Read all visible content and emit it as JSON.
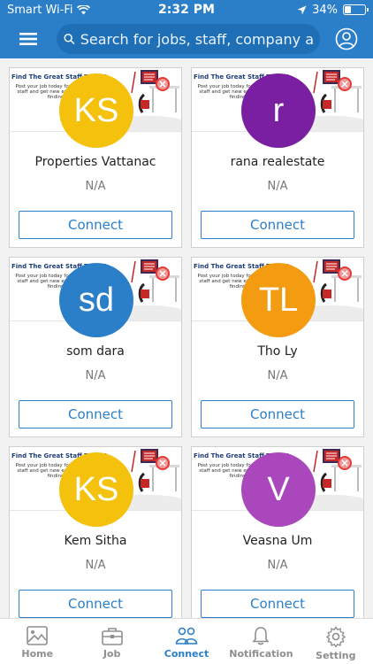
{
  "status": {
    "carrier": "Smart Wi-Fi",
    "time": "2:32 PM",
    "battery": "34%",
    "battery_level": 0.34
  },
  "header": {
    "search_placeholder": "Search for jobs, staff, company and oth..."
  },
  "banner": {
    "title": "Find The Great Staff Today!",
    "subtitle": "Post your job today for find great staff and get new experience in finding"
  },
  "cards": [
    {
      "initials": "KS",
      "color": "#f4c20d",
      "name": "Properties Vattanac",
      "sub": "N/A",
      "button": "Connect"
    },
    {
      "initials": "r",
      "color": "#7b1fa2",
      "name": "rana realestate",
      "sub": "N/A",
      "button": "Connect"
    },
    {
      "initials": "sd",
      "color": "#2b7fc9",
      "name": "som dara",
      "sub": "N/A",
      "button": "Connect"
    },
    {
      "initials": "TL",
      "color": "#f39c12",
      "name": "Tho Ly",
      "sub": "N/A",
      "button": "Connect"
    },
    {
      "initials": "KS",
      "color": "#f4c20d",
      "name": "Kem Sitha",
      "sub": "N/A",
      "button": "Connect"
    },
    {
      "initials": "V",
      "color": "#ab47bc",
      "name": "Veasna Um",
      "sub": "N/A",
      "button": "Connect"
    }
  ],
  "tabs": [
    {
      "label": "Home",
      "icon": "image-icon"
    },
    {
      "label": "Job",
      "icon": "briefcase-icon"
    },
    {
      "label": "Connect",
      "icon": "people-icon",
      "active": true
    },
    {
      "label": "Notification",
      "icon": "bell-icon"
    },
    {
      "label": "Setting",
      "icon": "gear-icon"
    }
  ]
}
